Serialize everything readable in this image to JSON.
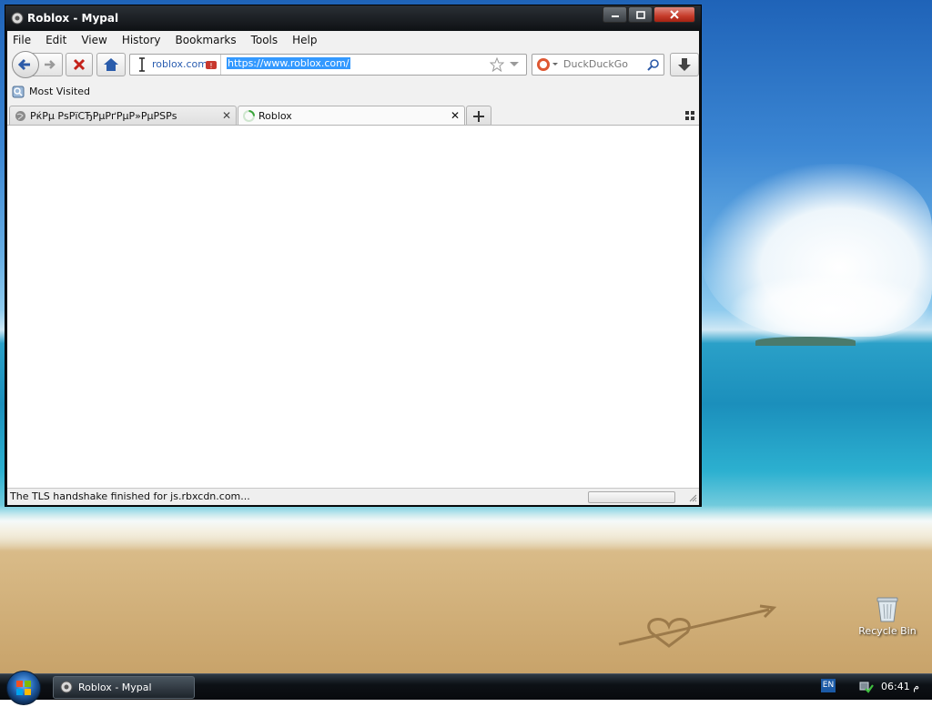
{
  "window": {
    "title": "Roblox - Mypal"
  },
  "menubar": {
    "items": [
      "File",
      "Edit",
      "View",
      "History",
      "Bookmarks",
      "Tools",
      "Help"
    ]
  },
  "navbar": {
    "identity_domain": "roblox.com",
    "url": "https://www.roblox.com/",
    "search_placeholder": "DuckDuckGo"
  },
  "bookmarks": {
    "most_visited": "Most Visited"
  },
  "tabs": [
    {
      "label": "РќРµ РѕРїСЂРµРґРµР»РµРЅРѕ",
      "active": false
    },
    {
      "label": "Roblox",
      "active": true
    }
  ],
  "status": {
    "text": "The TLS handshake finished for js.rbxcdn.com..."
  },
  "desktop": {
    "recycle_bin": "Recycle Bin"
  },
  "taskbar": {
    "item_label": "Roblox - Mypal",
    "language": "EN",
    "clock": "06:41 م"
  },
  "colors": {
    "url_highlight": "#3399ff",
    "close_button": "#c63c2b"
  }
}
